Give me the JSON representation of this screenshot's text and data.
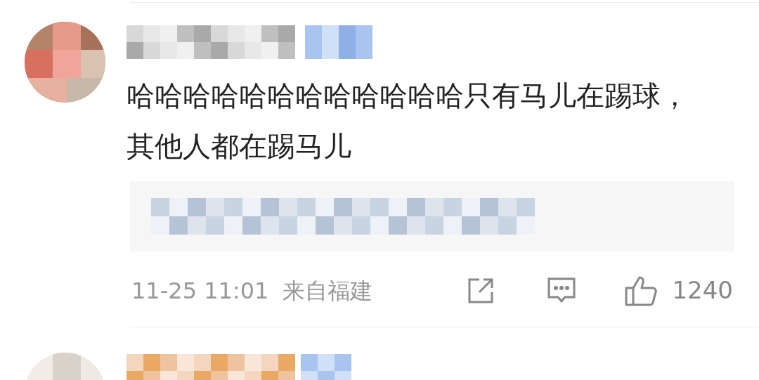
{
  "comments": [
    {
      "text": "哈哈哈哈哈哈哈哈哈哈哈哈只有马儿在踢球，其他人都在踢马儿",
      "time": "11-25 11:01",
      "location": "来自福建",
      "likes": "1240"
    }
  ]
}
